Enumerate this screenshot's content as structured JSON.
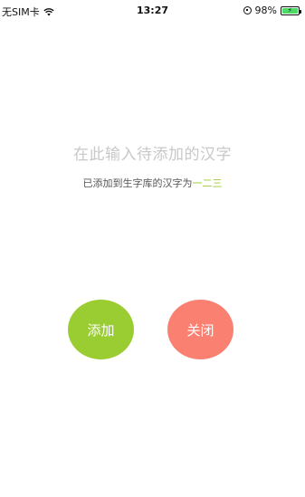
{
  "status_bar": {
    "carrier": "无SIM卡",
    "time": "13:27",
    "battery_percent": "98%",
    "battery_level": 0.98,
    "icons": [
      "wifi-icon",
      "rotation-lock-icon",
      "battery-icon"
    ]
  },
  "input": {
    "placeholder": "在此输入待添加的汉字"
  },
  "added": {
    "prefix": "已添加到生字库的汉字为",
    "chars": "一二三",
    "chars_color": "#9acd32"
  },
  "buttons": {
    "add_label": "添加",
    "add_color": "#9acd32",
    "close_label": "关闭",
    "close_color": "#fa8072"
  }
}
